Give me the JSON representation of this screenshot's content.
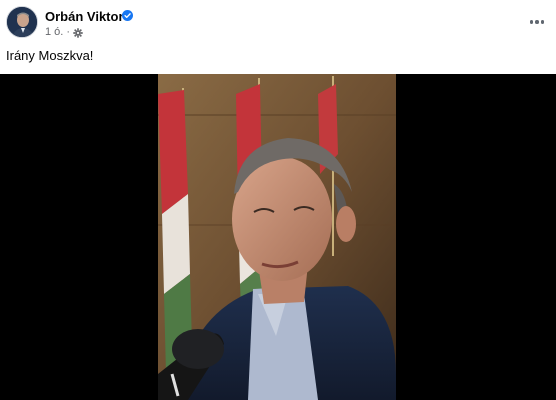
{
  "post": {
    "author": "Orbán Viktor",
    "verified": true,
    "time": "1 ó.",
    "separator": "·",
    "privacy_icon": "settings-gear-icon",
    "text": "Irány Moszkva!",
    "more_icon": "more-options-icon"
  },
  "colors": {
    "verified_blue": "#1877f2",
    "meta_gray": "#65676b",
    "video_bg": "#000000"
  }
}
